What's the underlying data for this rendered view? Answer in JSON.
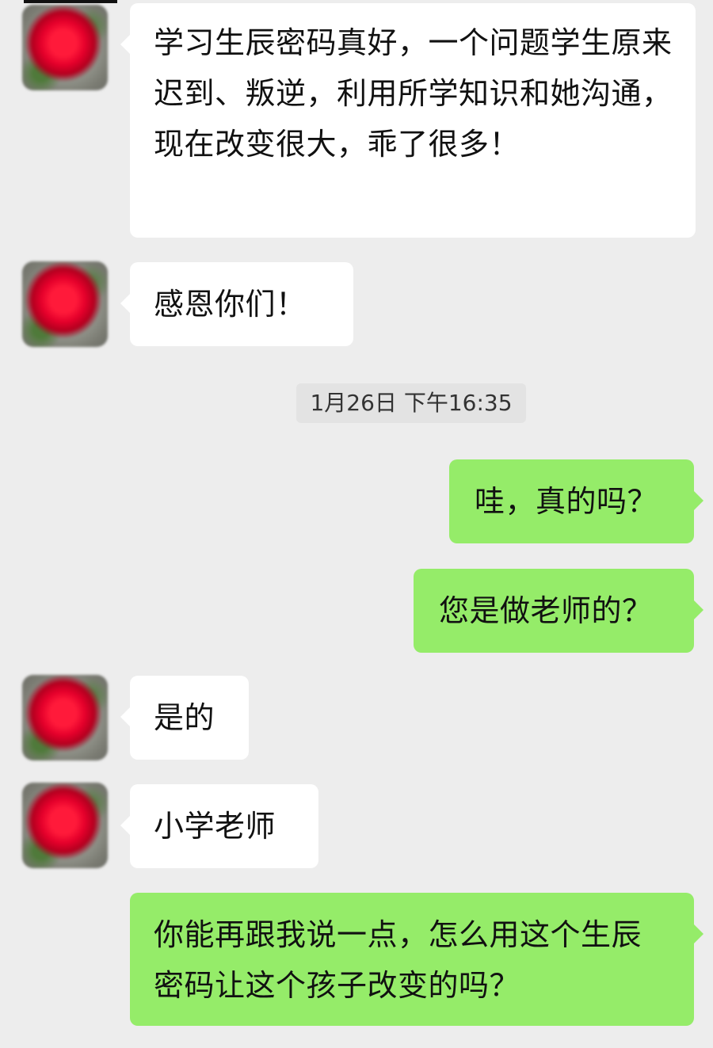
{
  "chat": {
    "timestamp": "1月26日 下午16:35",
    "messages": [
      {
        "side": "left",
        "text": "学习生辰密码真好，一个问题学生原来迟到、叛逆，利用所学知识和她沟通，现在改变很大，乖了很多！"
      },
      {
        "side": "left",
        "text": "感恩你们！"
      },
      {
        "side": "right",
        "text": "哇，真的吗？"
      },
      {
        "side": "right",
        "text": "您是做老师的？"
      },
      {
        "side": "left",
        "text": "是的"
      },
      {
        "side": "left",
        "text": "小学老师"
      },
      {
        "side": "right",
        "text": "你能再跟我说一点，怎么用这个生辰密码让这个孩子改变的吗？"
      }
    ]
  },
  "colors": {
    "background": "#ededed",
    "incoming_bubble": "#ffffff",
    "outgoing_bubble": "#95ec69",
    "timestamp_chip": "#e3e3e3"
  },
  "icons": {
    "avatar": "rose-avatar-icon"
  }
}
